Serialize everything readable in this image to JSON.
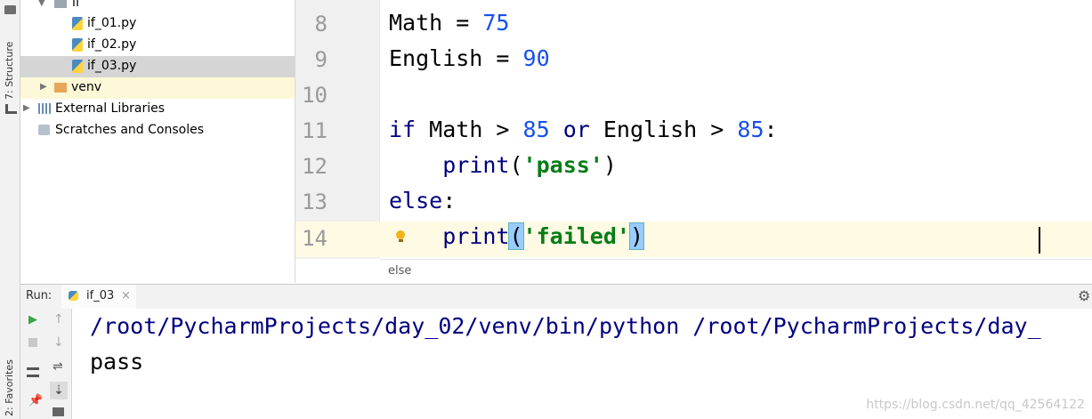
{
  "tool_strip": {
    "structure_label": "7: Structure",
    "favorites_label": "2: Favorites"
  },
  "project_tree": {
    "items": [
      {
        "label": "if",
        "type": "folder"
      },
      {
        "label": "if_01.py",
        "type": "python-file"
      },
      {
        "label": "if_02.py",
        "type": "python-file"
      },
      {
        "label": "if_03.py",
        "type": "python-file",
        "selected": true
      },
      {
        "label": "venv",
        "type": "folder"
      },
      {
        "label": "External Libraries",
        "type": "libraries"
      },
      {
        "label": "Scratches and Consoles",
        "type": "scratches"
      }
    ]
  },
  "editor": {
    "line_numbers": [
      "8",
      "9",
      "10",
      "11",
      "12",
      "13",
      "14"
    ],
    "current_line": "14",
    "lines": [
      {
        "tokens": [
          {
            "t": "Math",
            "c": "id"
          },
          {
            "t": " = ",
            "c": "op"
          },
          {
            "t": "75",
            "c": "num"
          }
        ]
      },
      {
        "tokens": [
          {
            "t": "English",
            "c": "id"
          },
          {
            "t": " = ",
            "c": "op"
          },
          {
            "t": "90",
            "c": "num"
          }
        ]
      },
      {
        "tokens": []
      },
      {
        "tokens": [
          {
            "t": "if",
            "c": "kw"
          },
          {
            "t": " Math > ",
            "c": "id"
          },
          {
            "t": "85",
            "c": "num"
          },
          {
            "t": " ",
            "c": "op"
          },
          {
            "t": "or",
            "c": "kw"
          },
          {
            "t": " English > ",
            "c": "id"
          },
          {
            "t": "85",
            "c": "num"
          },
          {
            "t": ":",
            "c": "op"
          }
        ]
      },
      {
        "tokens": [
          {
            "t": "    ",
            "c": "op"
          },
          {
            "t": "print",
            "c": "fn"
          },
          {
            "t": "(",
            "c": "op"
          },
          {
            "t": "'pass'",
            "c": "str"
          },
          {
            "t": ")",
            "c": "op"
          }
        ]
      },
      {
        "tokens": [
          {
            "t": "else",
            "c": "kw"
          },
          {
            "t": ":",
            "c": "op"
          }
        ]
      },
      {
        "tokens": [
          {
            "t": "    ",
            "c": "op"
          },
          {
            "t": "print",
            "c": "fn"
          },
          {
            "t": "(",
            "c": "brace"
          },
          {
            "t": "'failed'",
            "c": "str"
          },
          {
            "t": ")",
            "c": "brace"
          }
        ]
      }
    ],
    "breadcrumb": "else"
  },
  "run_panel": {
    "label": "Run:",
    "tab_label": "if_03",
    "close_glyph": "×",
    "output_lines": [
      "/root/PycharmProjects/day_02/venv/bin/python /root/PycharmProjects/day_",
      "pass"
    ],
    "watermark": "https://blog.csdn.net/qq_42564122"
  },
  "colors": {
    "keyword": "#000080",
    "number": "#1750eb",
    "string": "#067d17",
    "selection": "#d5d5d5",
    "current_line": "#fffae3"
  }
}
